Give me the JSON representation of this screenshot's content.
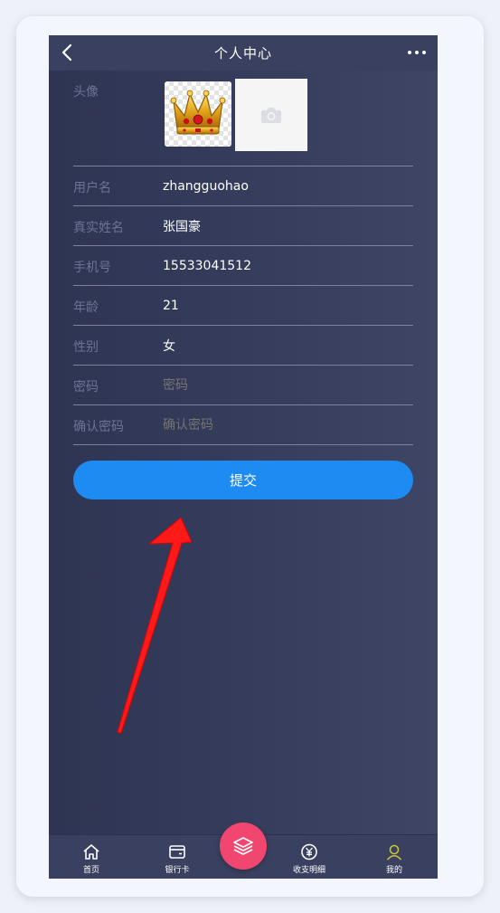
{
  "header": {
    "title": "个人中心",
    "back_icon": "chevron-left-icon",
    "more_icon": "more-dots-icon"
  },
  "form": {
    "avatar_label": "头像",
    "avatar_icon": "crown-icon",
    "upload_icon": "camera-icon",
    "fields": [
      {
        "label": "用户名",
        "value": "zhangguohao"
      },
      {
        "label": "真实姓名",
        "value": "张国豪"
      },
      {
        "label": "手机号",
        "value": "15533041512"
      },
      {
        "label": "年龄",
        "value": "21"
      },
      {
        "label": "性别",
        "value": "女"
      },
      {
        "label": "密码",
        "placeholder": "密码"
      },
      {
        "label": "确认密码",
        "placeholder": "确认密码"
      }
    ]
  },
  "submit_label": "提交",
  "tabbar": {
    "items": [
      {
        "label": "首页",
        "icon": "home-icon"
      },
      {
        "label": "银行卡",
        "icon": "card-icon"
      },
      {
        "label": "收支明细",
        "icon": "yuan-icon"
      },
      {
        "label": "我的",
        "icon": "user-icon"
      }
    ],
    "center_icon": "layers-icon"
  },
  "colors": {
    "background": "#363d5c",
    "primary_button": "#1d8bf2",
    "center_button": "#f0466f",
    "active_tab_icon": "#c8c43a",
    "annotation_arrow": "#ff1a1a"
  }
}
